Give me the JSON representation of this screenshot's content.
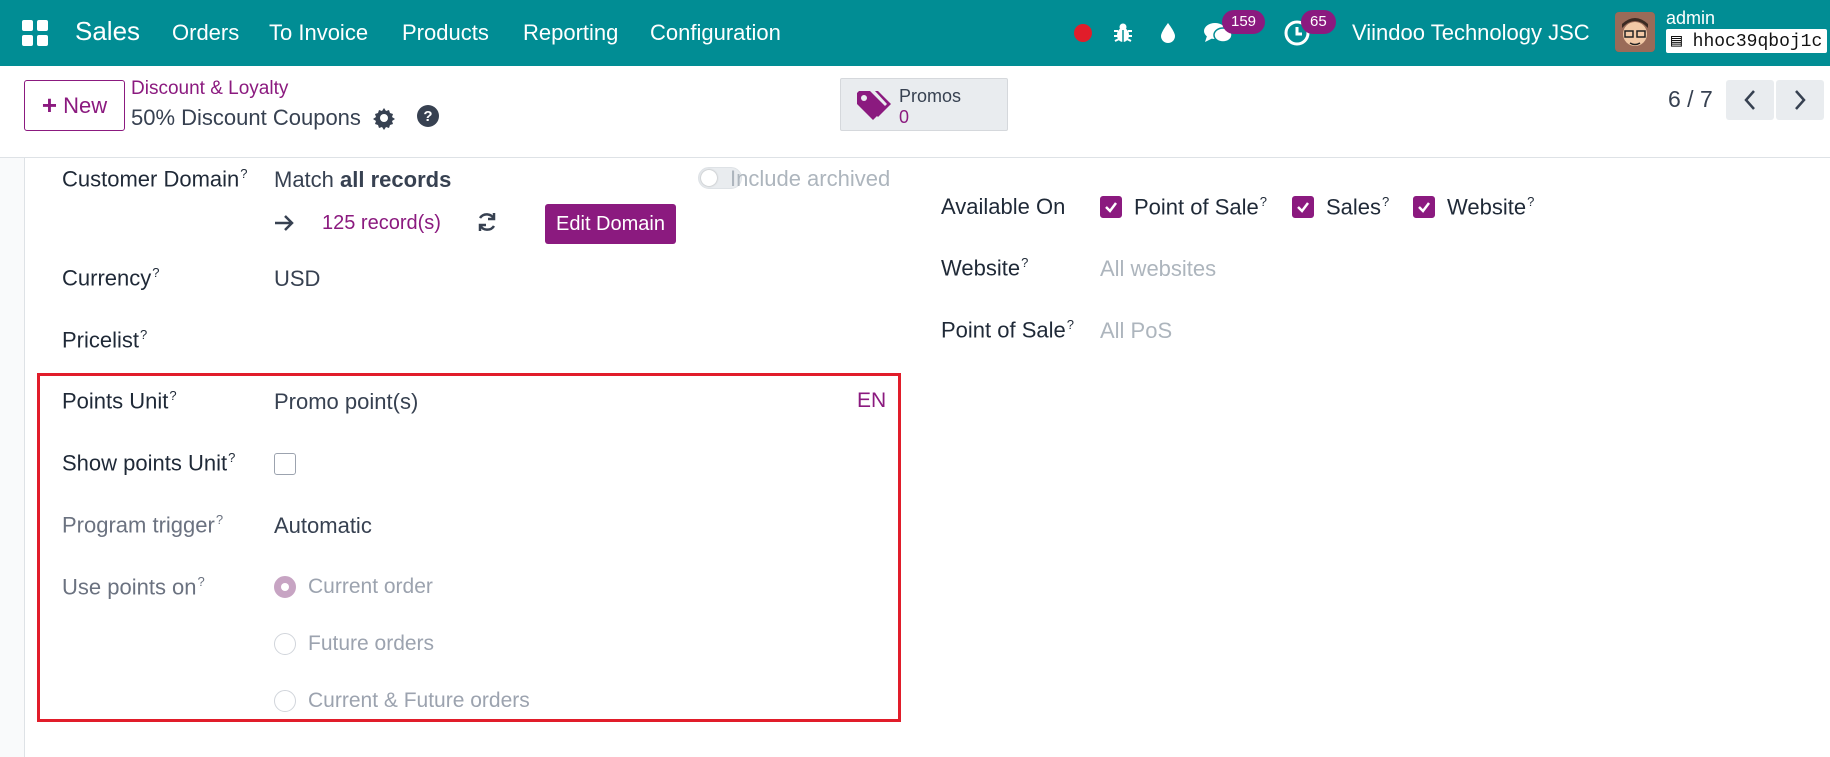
{
  "navbar": {
    "brand": "Sales",
    "menu": [
      "Orders",
      "To Invoice",
      "Products",
      "Reporting",
      "Configuration"
    ],
    "messages_count": "159",
    "activities_count": "65",
    "company": "Viindoo Technology JSC",
    "user": "admin",
    "database": "hhoc39qboj1c",
    "record_dot_color": "#e11d2a"
  },
  "control": {
    "new_label": "New",
    "breadcrumb": "Discount & Loyalty",
    "title": "50% Discount Coupons",
    "promos_label": "Promos",
    "promos_count": "0",
    "pager": "6 / 7"
  },
  "form": {
    "customer_domain": {
      "label": "Customer Domain",
      "match_prefix": "Match",
      "match_bold": "all records",
      "records_link": "125 record(s)",
      "edit_button": "Edit Domain",
      "include_archived": "Include archived"
    },
    "currency": {
      "label": "Currency",
      "value": "USD"
    },
    "pricelist": {
      "label": "Pricelist"
    },
    "points_unit": {
      "label": "Points Unit",
      "value": "Promo point(s)",
      "lang": "EN"
    },
    "show_points_unit": {
      "label": "Show points Unit",
      "checked": false
    },
    "program_trigger": {
      "label": "Program trigger",
      "value": "Automatic"
    },
    "use_points_on": {
      "label": "Use points on",
      "options": [
        "Current order",
        "Future orders",
        "Current & Future orders"
      ],
      "selected": "Current order"
    },
    "available_on": {
      "label": "Available On",
      "options": [
        {
          "label": "Point of Sale",
          "checked": true
        },
        {
          "label": "Sales",
          "checked": true
        },
        {
          "label": "Website",
          "checked": true
        }
      ]
    },
    "website": {
      "label": "Website",
      "placeholder": "All websites"
    },
    "point_of_sale": {
      "label": "Point of Sale",
      "placeholder": "All PoS"
    },
    "help_mark": "?"
  }
}
